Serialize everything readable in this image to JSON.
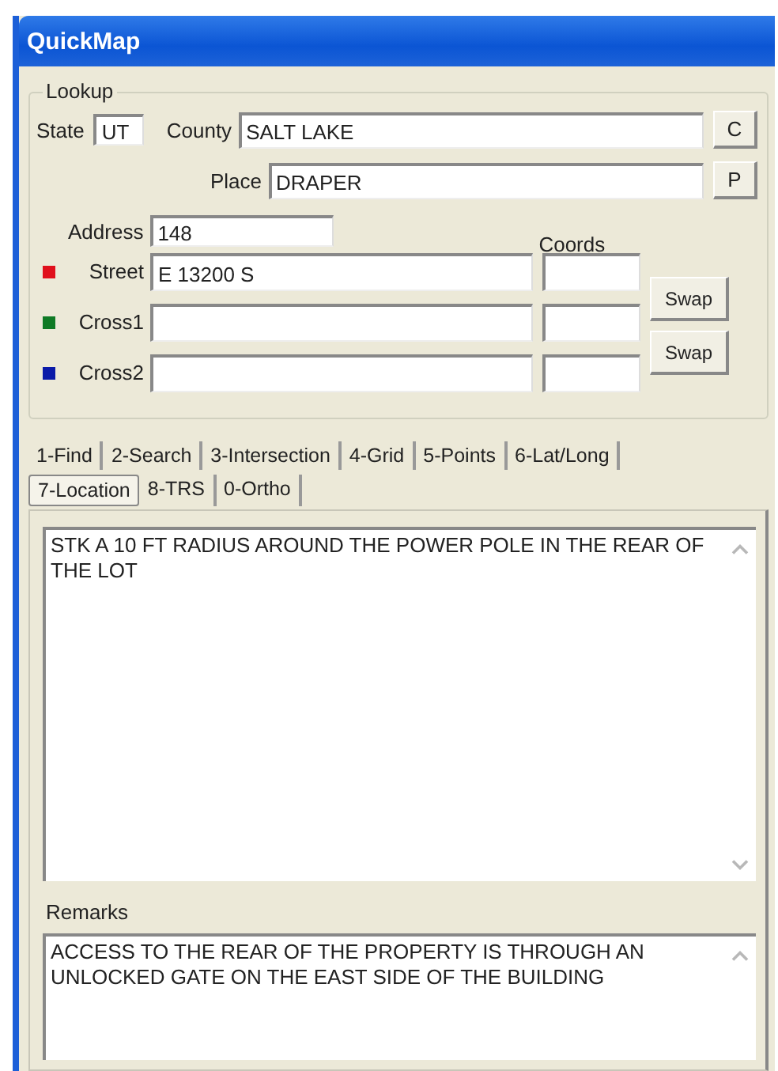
{
  "window": {
    "title": "QuickMap"
  },
  "lookup": {
    "title": "Lookup",
    "state": {
      "label": "State",
      "value": "UT"
    },
    "county": {
      "label": "County",
      "value": "SALT LAKE",
      "button": "C"
    },
    "place": {
      "label": "Place",
      "value": "DRAPER",
      "button": "P"
    },
    "address": {
      "label": "Address",
      "value": "148"
    },
    "coords_label": "Coords",
    "streets": [
      {
        "label": "Street",
        "color": "#e0101c",
        "value": "E 13200 S"
      },
      {
        "label": "Cross1",
        "color": "#0f7a25"
      },
      {
        "label": "Cross2",
        "color": "#0a1aa8"
      }
    ],
    "swap_buttons": [
      "Swap",
      "Swap"
    ]
  },
  "tab_rows": [
    [
      {
        "label": "1-Find",
        "selected": false
      },
      {
        "label": "2-Search",
        "selected": false
      },
      {
        "label": "3-Intersection",
        "selected": false
      },
      {
        "label": "4-Grid",
        "selected": false
      },
      {
        "label": "5-Points",
        "selected": false
      },
      {
        "label": "6-Lat/Long",
        "selected": false
      }
    ],
    [
      {
        "label": "7-Location",
        "selected": true
      },
      {
        "label": "8-TRS",
        "selected": false
      },
      {
        "label": "0-Ortho",
        "selected": false
      }
    ]
  ],
  "location_text": "STK A 10 FT RADIUS AROUND THE POWER POLE IN THE REAR OF THE LOT",
  "remarks": {
    "label": "Remarks",
    "text": "ACCESS TO THE REAR OF THE PROPERTY IS THROUGH AN UNLOCKED GATE ON THE EAST SIDE OF THE BUILDING"
  }
}
